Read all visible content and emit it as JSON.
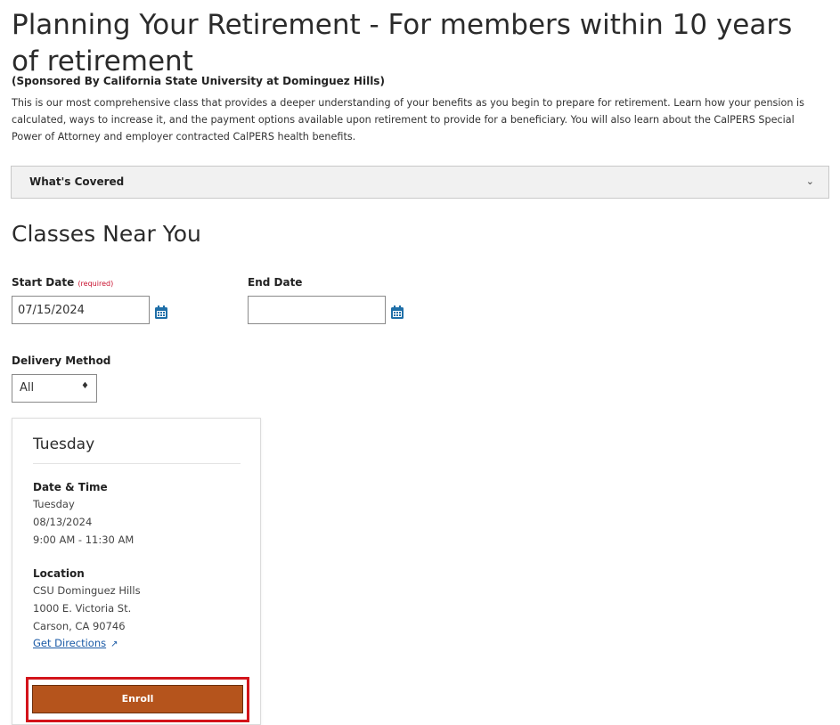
{
  "header": {
    "title": "Planning Your Retirement - For members within 10 years of retirement",
    "sponsor": "(Sponsored By California State University at Dominguez Hills)",
    "description": "This is our most comprehensive class that provides a deeper understanding of your benefits as you begin to prepare for retirement. Learn how your pension is calculated, ways to increase it, and the payment options available upon retirement to provide for a beneficiary. You will also learn about the CalPERS Special Power of Attorney and employer contracted CalPERS health benefits."
  },
  "accordion": {
    "label": "What's Covered",
    "icon": "chevron-down-icon"
  },
  "classes": {
    "title": "Classes Near You",
    "start_date": {
      "label": "Start Date",
      "required_text": "(required)",
      "value": "07/15/2024"
    },
    "end_date": {
      "label": "End Date",
      "value": ""
    },
    "delivery": {
      "label": "Delivery Method",
      "value": "All"
    }
  },
  "card": {
    "day": "Tuesday",
    "datetime_label": "Date & Time",
    "datetime_day": "Tuesday",
    "date": "08/13/2024",
    "time": "9:00 AM - 11:30 AM",
    "location_label": "Location",
    "location_name": "CSU Dominguez Hills",
    "address1": "1000 E. Victoria St.",
    "address2": "Carson, CA 90746",
    "directions": "Get Directions",
    "enroll": "Enroll"
  },
  "colors": {
    "enroll_bg": "#b5541c",
    "highlight": "#d3141b",
    "link": "#1a5aa6",
    "calendar_icon": "#1f6fa8"
  }
}
